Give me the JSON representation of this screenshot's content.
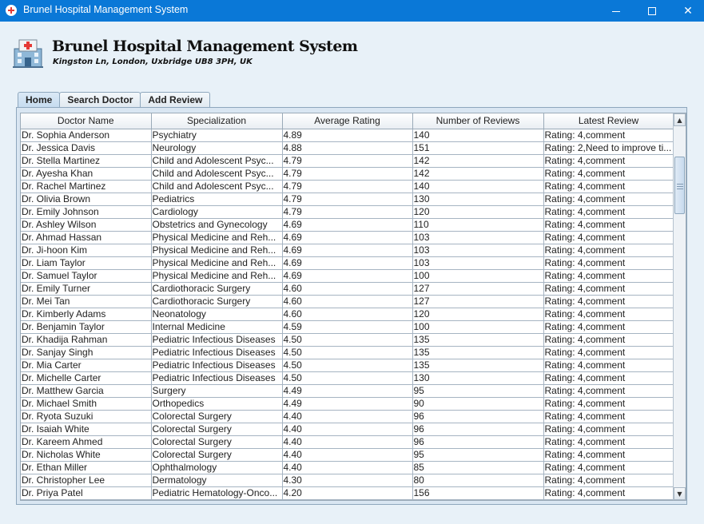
{
  "window": {
    "title": "Brunel Hospital Management System",
    "controls": {
      "minimize": "",
      "maximize": "",
      "close": "✕"
    }
  },
  "header": {
    "title": "Brunel Hospital Management System",
    "address": "Kingston Ln, London, Uxbridge UB8 3PH, UK",
    "icon": "hospital-building-icon"
  },
  "tabs": [
    {
      "label": "Home",
      "active": true
    },
    {
      "label": "Search Doctor",
      "active": false
    },
    {
      "label": "Add Review",
      "active": false
    }
  ],
  "table": {
    "columns": [
      "Doctor Name",
      "Specialization",
      "Average Rating",
      "Number of Reviews",
      "Latest Review"
    ],
    "rows": [
      [
        "Dr. Sophia Anderson",
        "Psychiatry",
        "4.89",
        "140",
        "Rating: 4,comment"
      ],
      [
        "Dr. Jessica Davis",
        "Neurology",
        "4.88",
        "151",
        "Rating: 2,Need to improve ti..."
      ],
      [
        "Dr. Stella Martinez",
        "Child and Adolescent Psyc...",
        "4.79",
        "142",
        "Rating: 4,comment"
      ],
      [
        "Dr. Ayesha Khan",
        "Child and Adolescent Psyc...",
        "4.79",
        "142",
        "Rating: 4,comment"
      ],
      [
        "Dr. Rachel Martinez",
        "Child and Adolescent Psyc...",
        "4.79",
        "140",
        "Rating: 4,comment"
      ],
      [
        "Dr. Olivia Brown",
        "Pediatrics",
        "4.79",
        "130",
        "Rating: 4,comment"
      ],
      [
        "Dr. Emily Johnson",
        "Cardiology",
        "4.79",
        "120",
        "Rating: 4,comment"
      ],
      [
        "Dr. Ashley Wilson",
        "Obstetrics and Gynecology",
        "4.69",
        "110",
        "Rating: 4,comment"
      ],
      [
        "Dr. Ahmad Hassan",
        "Physical Medicine and Reh...",
        "4.69",
        "103",
        "Rating: 4,comment"
      ],
      [
        "Dr. Ji-hoon Kim",
        "Physical Medicine and Reh...",
        "4.69",
        "103",
        "Rating: 4,comment"
      ],
      [
        "Dr. Liam Taylor",
        "Physical Medicine and Reh...",
        "4.69",
        "103",
        "Rating: 4,comment"
      ],
      [
        "Dr. Samuel Taylor",
        "Physical Medicine and Reh...",
        "4.69",
        "100",
        "Rating: 4,comment"
      ],
      [
        "Dr. Emily Turner",
        "Cardiothoracic Surgery",
        "4.60",
        "127",
        "Rating: 4,comment"
      ],
      [
        "Dr. Mei Tan",
        "Cardiothoracic Surgery",
        "4.60",
        "127",
        "Rating: 4,comment"
      ],
      [
        "Dr. Kimberly Adams",
        "Neonatology",
        "4.60",
        "120",
        "Rating: 4,comment"
      ],
      [
        "Dr. Benjamin Taylor",
        "Internal Medicine",
        "4.59",
        "100",
        "Rating: 4,comment"
      ],
      [
        "Dr. Khadija Rahman",
        "Pediatric Infectious Diseases",
        "4.50",
        "135",
        "Rating: 4,comment"
      ],
      [
        "Dr. Sanjay Singh",
        "Pediatric Infectious Diseases",
        "4.50",
        "135",
        "Rating: 4,comment"
      ],
      [
        "Dr. Mia Carter",
        "Pediatric Infectious Diseases",
        "4.50",
        "135",
        "Rating: 4,comment"
      ],
      [
        "Dr. Michelle Carter",
        "Pediatric Infectious Diseases",
        "4.50",
        "130",
        "Rating: 4,comment"
      ],
      [
        "Dr. Matthew Garcia",
        "Surgery",
        "4.49",
        "95",
        "Rating: 4,comment"
      ],
      [
        "Dr. Michael Smith",
        "Orthopedics",
        "4.49",
        "90",
        "Rating: 4,comment"
      ],
      [
        "Dr. Ryota Suzuki",
        "Colorectal Surgery",
        "4.40",
        "96",
        "Rating: 4,comment"
      ],
      [
        "Dr. Isaiah White",
        "Colorectal Surgery",
        "4.40",
        "96",
        "Rating: 4,comment"
      ],
      [
        "Dr. Kareem Ahmed",
        "Colorectal Surgery",
        "4.40",
        "96",
        "Rating: 4,comment"
      ],
      [
        "Dr. Nicholas White",
        "Colorectal Surgery",
        "4.40",
        "95",
        "Rating: 4,comment"
      ],
      [
        "Dr. Ethan Miller",
        "Ophthalmology",
        "4.40",
        "85",
        "Rating: 4,comment"
      ],
      [
        "Dr. Christopher Lee",
        "Dermatology",
        "4.30",
        "80",
        "Rating: 4,comment"
      ],
      [
        "Dr. Priya Patel",
        "Pediatric Hematology-Onco...",
        "4.20",
        "156",
        "Rating: 4,comment"
      ]
    ]
  },
  "scrollbar": {
    "position_fraction": 0.1,
    "visible_fraction": 0.16
  },
  "colors": {
    "titlebar": "#0a78d7",
    "background": "#e8f1f8",
    "tab_active": "#c5dbef"
  }
}
